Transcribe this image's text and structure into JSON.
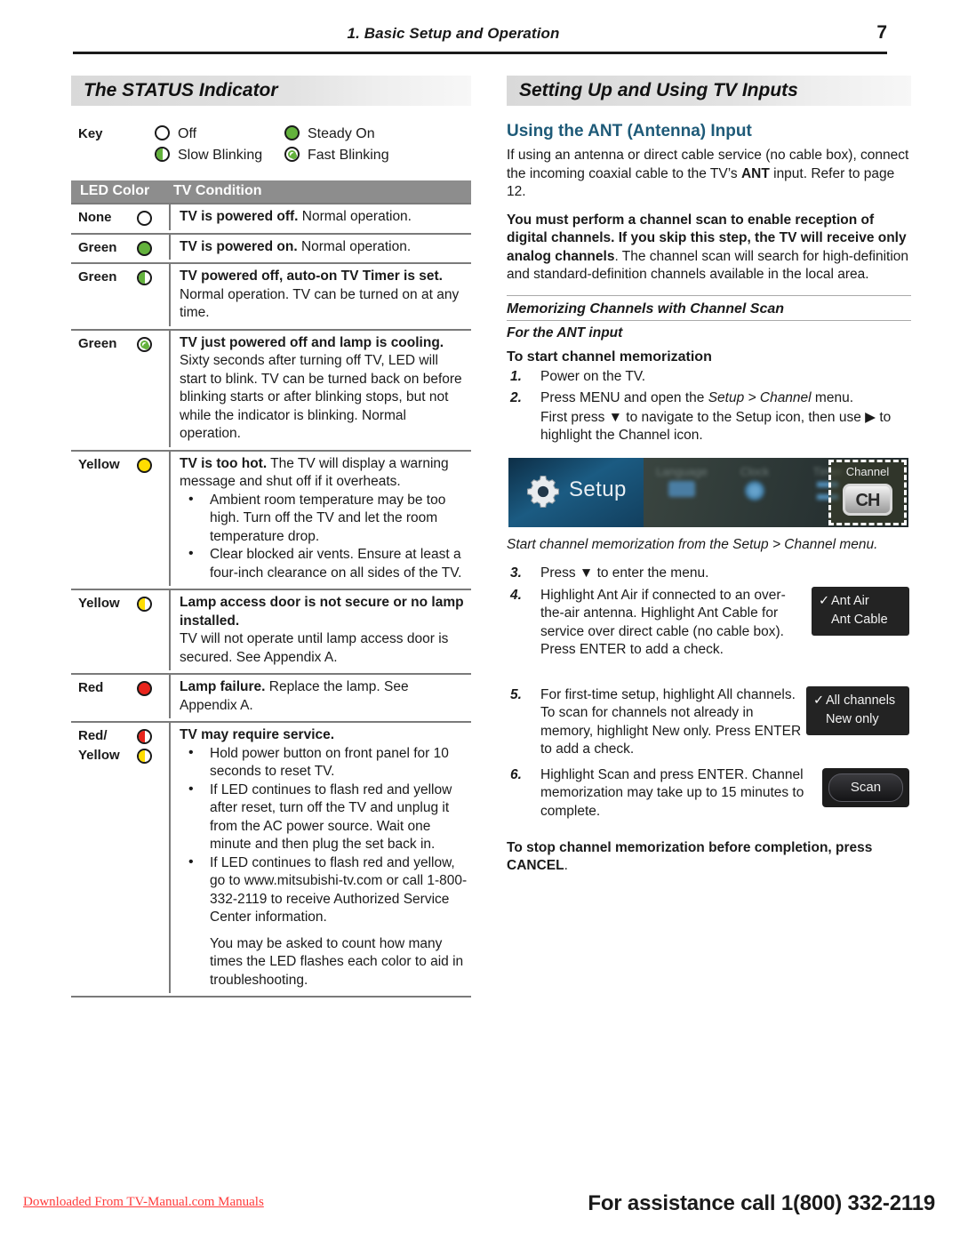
{
  "header": {
    "chapter": "1.  Basic Setup and Operation",
    "page_number": "7"
  },
  "left_column": {
    "section_title": "The STATUS Indicator",
    "key": {
      "label": "Key",
      "items": [
        {
          "icon": "led-off-icon",
          "label": "Off"
        },
        {
          "icon": "led-steady-on-icon",
          "label": "Steady On"
        },
        {
          "icon": "led-slow-blinking-icon",
          "label": "Slow Blinking"
        },
        {
          "icon": "led-fast-blinking-icon",
          "label": "Fast Blinking"
        }
      ]
    },
    "table": {
      "headers": [
        "LED Color",
        "TV Condition"
      ],
      "rows": [
        {
          "color": "None",
          "icon": "led-off-icon",
          "bold": "TV is powered off.",
          "text": " Normal operation."
        },
        {
          "color": "Green",
          "icon": "led-steady-green-icon",
          "bold": "TV is powered on.",
          "text": " Normal operation."
        },
        {
          "color": "Green",
          "icon": "led-half-green-icon",
          "bold": "TV powered off, auto-on TV Timer is set.",
          "text": "",
          "para": "Normal operation.  TV can be turned on at any time."
        },
        {
          "color": "Green",
          "icon": "led-ring-green-icon",
          "bold": "TV just powered off and lamp is cooling.",
          "text": "",
          "para": "Sixty seconds after turning off TV, LED will start to blink.  TV can be turned back on before blinking starts or after blinking stops, but not while the indicator is blinking.  Normal operation."
        },
        {
          "color": "Yellow",
          "icon": "led-steady-yellow-icon",
          "bold": "TV is too hot.",
          "text": "  The TV will display a warning message and shut off if it overheats.",
          "bullets": [
            "Ambient room temperature may be too high.  Turn off the TV and let the room temperature drop.",
            "Clear blocked air vents.  Ensure at least a four-inch clearance on all sides of the TV."
          ]
        },
        {
          "color": "Yellow",
          "icon": "led-half-yellow-icon",
          "bold": "Lamp access door is not secure or no lamp installed.",
          "text": "",
          "para": "TV will not operate until lamp access door is secured.  See Appendix A."
        },
        {
          "color": "Red",
          "icon": "led-steady-red-icon",
          "bold": "Lamp failure.",
          "text": "  Replace the lamp.  See Appendix A."
        },
        {
          "color": "Red/",
          "color2": "Yellow",
          "icon": "led-half-red-icon",
          "icon2": "led-half-yellow-icon",
          "bold": "TV may require service.",
          "text": "",
          "bullets": [
            "Hold power button on front panel for 10 seconds to reset TV.",
            "If LED continues to flash red and yellow after reset, turn off the TV and unplug it from the AC power source.  Wait one minute and then plug the set back in.",
            "If LED continues to flash red and yellow, go to www.mitsubishi-tv.com or call 1-800-332-2119 to receive Authorized Service Center information."
          ],
          "trailing": "You may be asked to count how many times the LED flashes each color to aid in troubleshooting."
        }
      ]
    }
  },
  "right_column": {
    "section_title": "Setting Up and Using TV Inputs",
    "ant_heading": "Using the ANT (Antenna) Input",
    "ant_para_1_a": "If using an antenna or direct cable service (no cable box), connect the incoming coaxial cable to the TV’s ",
    "ant_para_1_b": "ANT",
    "ant_para_1_c": " input.  Refer to page 12.",
    "ant_para_2_bold": "You must perform a channel scan to enable reception of digital channels.  If you skip this step, the TV will receive only analog channels",
    "ant_para_2_rest": ".  The channel scan will search for high-definition and standard-definition channels available in the local area.",
    "memorizing_heading": "Memorizing Channels with Channel Scan",
    "for_ant_input": "For the ANT input",
    "to_start_heading": "To start channel memorization",
    "steps": [
      {
        "num": "1.",
        "text": "Power on the TV."
      },
      {
        "num": "2.",
        "text_a": "Press ",
        "text_b": "MENU",
        "text_c": " and open the ",
        "text_d": "Setup > Channel",
        "text_e": " menu.",
        "sub": "First press ▼ to navigate to the Setup icon, then use ▶ to highlight the Channel icon."
      },
      {
        "num": "3.",
        "text": "Press ▼ to enter the menu."
      },
      {
        "num": "4.",
        "text_a": "Highlight ",
        "text_b": "Ant Air",
        "text_c": " if connected to an over-the-air antenna.  Highlight ",
        "text_d": "Ant Cable",
        "text_e": " for service over direct cable (no cable box).  Press ",
        "text_f": "ENTER",
        "text_g": " to add a check."
      },
      {
        "num": "5.",
        "text_a": "For first-time setup, highlight ",
        "text_b": "All channels",
        "text_c": ".  To scan for channels not already in memory, highlight ",
        "text_d": "New only",
        "text_e": ".  Press ",
        "text_f": "ENTER",
        "text_g": " to add a check."
      },
      {
        "num": "6.",
        "text_a": "Highlight ",
        "text_b": "Scan",
        "text_c": " and press ",
        "text_d": "ENTER",
        "text_e": ".  Channel memorization may take up to 15 minutes to complete."
      }
    ],
    "setup_figure": {
      "setup_label": "Setup",
      "blurred_items": [
        "Language",
        "Clock",
        "Timer"
      ],
      "selected_label": "Channel",
      "selected_icon_text": "CH"
    },
    "figure_caption": "Start channel memorization from the Setup > Channel menu.",
    "chip_antenna": {
      "checked": "Ant Air",
      "unchecked": "Ant Cable",
      "check_glyph": "✓"
    },
    "chip_channels": {
      "checked": "All channels",
      "unchecked": "New only",
      "check_glyph": "✓"
    },
    "chip_scan": {
      "label": "Scan"
    },
    "stop_note_a": "To stop channel memorization before completion, press ",
    "stop_note_b": "CANCEL",
    "stop_note_c": "."
  },
  "footer": {
    "left": "Downloaded From TV-Manual.com Manuals",
    "right": "For assistance call 1(800) 332-2119"
  },
  "colors": {
    "green": "#63b23c",
    "yellow": "#ffdd00",
    "red": "#e8241c",
    "heading_blue": "#1e5a78",
    "table_header_gray": "#8d8d8d",
    "footer_red": "#ff3b3b"
  }
}
